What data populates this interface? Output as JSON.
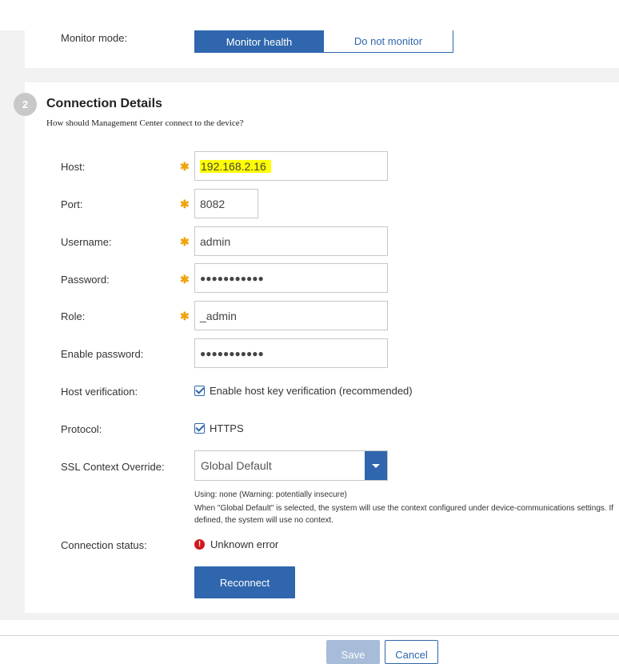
{
  "monitor": {
    "label": "Monitor mode:",
    "options": [
      "Monitor health",
      "Do not monitor"
    ],
    "selected": "Monitor health"
  },
  "section": {
    "step": "2",
    "title": "Connection Details",
    "description": "How should Management Center connect to the device?"
  },
  "fields": {
    "host": {
      "label": "Host:",
      "value": "192.168.2.16"
    },
    "port": {
      "label": "Port:",
      "value": "8082"
    },
    "username": {
      "label": "Username:",
      "value": "admin"
    },
    "password": {
      "label": "Password:",
      "value": "●●●●●●●●●●●"
    },
    "role": {
      "label": "Role:",
      "value": "_admin"
    },
    "enable_password": {
      "label": "Enable password:",
      "value": "●●●●●●●●●●●"
    }
  },
  "host_verification": {
    "label": "Host verification:",
    "checkbox_label": "Enable host key verification (recommended)",
    "checked": true
  },
  "protocol": {
    "label": "Protocol:",
    "checkbox_label": "HTTPS",
    "checked": true
  },
  "ssl": {
    "label": "SSL Context Override:",
    "value": "Global Default",
    "note1": "Using: none (Warning: potentially insecure)",
    "note2": "When \"Global Default\" is selected, the system will use the context configured under device-communications settings. If",
    "note3": "defined, the system will use no context."
  },
  "connection": {
    "label": "Connection status:",
    "status": "Unknown error"
  },
  "buttons": {
    "reconnect": "Reconnect",
    "save": "Save",
    "cancel": "Cancel"
  },
  "colors": {
    "primary": "#2f66ad",
    "required": "#f0a30a",
    "error": "#d0191b",
    "highlight": "#ffff00"
  },
  "icons": {
    "required": "asterisk-icon",
    "checkbox": "checkbox-checked-icon",
    "dropdown": "caret-down-icon",
    "error": "exclamation-circle-icon"
  }
}
